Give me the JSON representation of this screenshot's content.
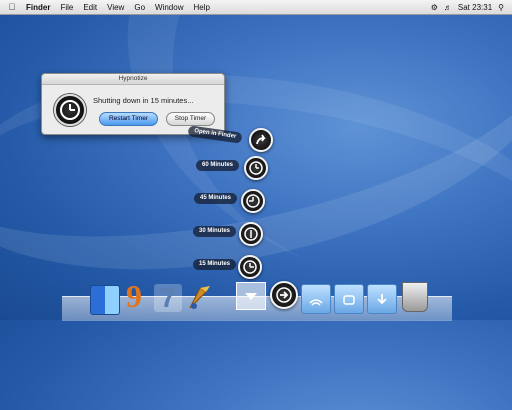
{
  "menubar": {
    "app_name": "Finder",
    "items": [
      "File",
      "Edit",
      "View",
      "Go",
      "Window",
      "Help"
    ],
    "clock": "Sat 23:31"
  },
  "dialog": {
    "title": "Hypnotize",
    "message": "Shutting down in 15 minutes...",
    "primary_button": "Restart Timer",
    "secondary_button": "Stop Timer"
  },
  "stack": {
    "items": [
      {
        "label": "Open in Finder",
        "icon": "arrow-curve-icon"
      },
      {
        "label": "60 Minutes",
        "icon": "clock-icon"
      },
      {
        "label": "45 Minutes",
        "icon": "clock-icon"
      },
      {
        "label": "30 Minutes",
        "icon": "clock-icon"
      },
      {
        "label": "15 Minutes",
        "icon": "clock-icon"
      }
    ]
  },
  "dock": {
    "items": [
      "finder-icon",
      "nine-icon",
      "seven-icon",
      "rocket-icon",
      "downloads-arrow-icon",
      "arrow-right-icon",
      "wifi-folder-icon",
      "apps-folder-icon",
      "downloads-folder-icon",
      "trash-icon"
    ]
  },
  "colors": {
    "accent": "#4a9af0",
    "desktop": "#3f74c2"
  }
}
